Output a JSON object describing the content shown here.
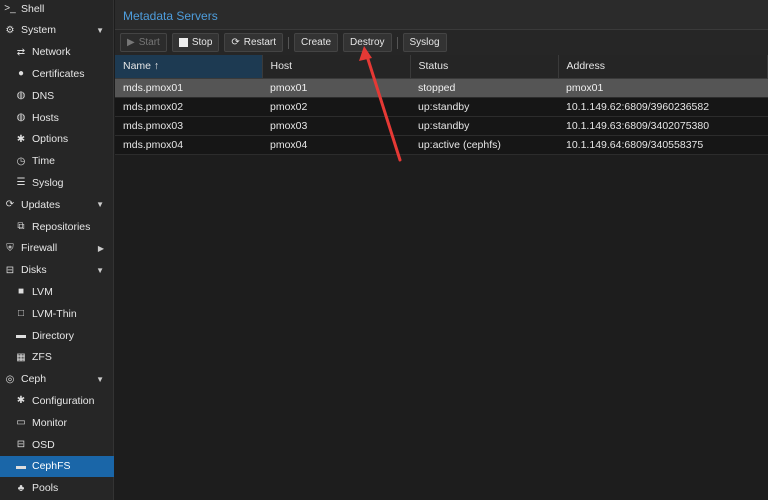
{
  "sidebar": {
    "items": [
      {
        "label": "Shell",
        "icon": "terminal-icon",
        "glyph": ">_",
        "level": 0
      },
      {
        "label": "System",
        "icon": "gears-icon",
        "glyph": "⚙",
        "level": 0,
        "caret": "▼"
      },
      {
        "label": "Network",
        "icon": "exchange-icon",
        "glyph": "⇄",
        "level": 1
      },
      {
        "label": "Certificates",
        "icon": "certificate-icon",
        "glyph": "●",
        "level": 1
      },
      {
        "label": "DNS",
        "icon": "globe-icon",
        "glyph": "◍",
        "level": 1
      },
      {
        "label": "Hosts",
        "icon": "globe-icon",
        "glyph": "◍",
        "level": 1
      },
      {
        "label": "Options",
        "icon": "gear-icon",
        "glyph": "✱",
        "level": 1
      },
      {
        "label": "Time",
        "icon": "clock-icon",
        "glyph": "◷",
        "level": 1
      },
      {
        "label": "Syslog",
        "icon": "list-icon",
        "glyph": "☰",
        "level": 1
      },
      {
        "label": "Updates",
        "icon": "refresh-icon",
        "glyph": "⟳",
        "level": 0,
        "caret": "▼"
      },
      {
        "label": "Repositories",
        "icon": "files-icon",
        "glyph": "⧉",
        "level": 1
      },
      {
        "label": "Firewall",
        "icon": "shield-icon",
        "glyph": "⛨",
        "level": 0,
        "caret": "▶"
      },
      {
        "label": "Disks",
        "icon": "hdd-icon",
        "glyph": "⊟",
        "level": 0,
        "caret": "▼"
      },
      {
        "label": "LVM",
        "icon": "square-icon",
        "glyph": "■",
        "level": 1
      },
      {
        "label": "LVM-Thin",
        "icon": "square-outline-icon",
        "glyph": "□",
        "level": 1
      },
      {
        "label": "Directory",
        "icon": "folder-icon",
        "glyph": "▬",
        "level": 1
      },
      {
        "label": "ZFS",
        "icon": "grid-icon",
        "glyph": "▦",
        "level": 1
      },
      {
        "label": "Ceph",
        "icon": "ceph-icon",
        "glyph": "◎",
        "level": 0,
        "caret": "▼"
      },
      {
        "label": "Configuration",
        "icon": "gear-icon",
        "glyph": "✱",
        "level": 1
      },
      {
        "label": "Monitor",
        "icon": "desktop-icon",
        "glyph": "▭",
        "level": 1
      },
      {
        "label": "OSD",
        "icon": "hdd-icon",
        "glyph": "⊟",
        "level": 1
      },
      {
        "label": "CephFS",
        "icon": "folder-icon",
        "glyph": "▬",
        "level": 1,
        "selected": true
      },
      {
        "label": "Pools",
        "icon": "sitemap-icon",
        "glyph": "♣",
        "level": 1
      }
    ]
  },
  "panel": {
    "title": "Metadata Servers"
  },
  "toolbar": {
    "start": "Start",
    "stop": "Stop",
    "restart": "Restart",
    "create": "Create",
    "destroy": "Destroy",
    "syslog": "Syslog"
  },
  "table": {
    "columns": [
      "Name ↑",
      "Host",
      "Status",
      "Address"
    ],
    "rows": [
      [
        "mds.pmox01",
        "pmox01",
        "stopped",
        "pmox01"
      ],
      [
        "mds.pmox02",
        "pmox02",
        "up:standby",
        "10.1.149.62:6809/3960236582"
      ],
      [
        "mds.pmox03",
        "pmox03",
        "up:standby",
        "10.1.149.63:6809/3402075380"
      ],
      [
        "mds.pmox04",
        "pmox04",
        "up:active (cephfs)",
        "10.1.149.64:6809/340558375"
      ]
    ]
  },
  "colors": {
    "accent": "#1a66a8",
    "title": "#4e9ddc",
    "annotation_arrow": "#e53935"
  }
}
